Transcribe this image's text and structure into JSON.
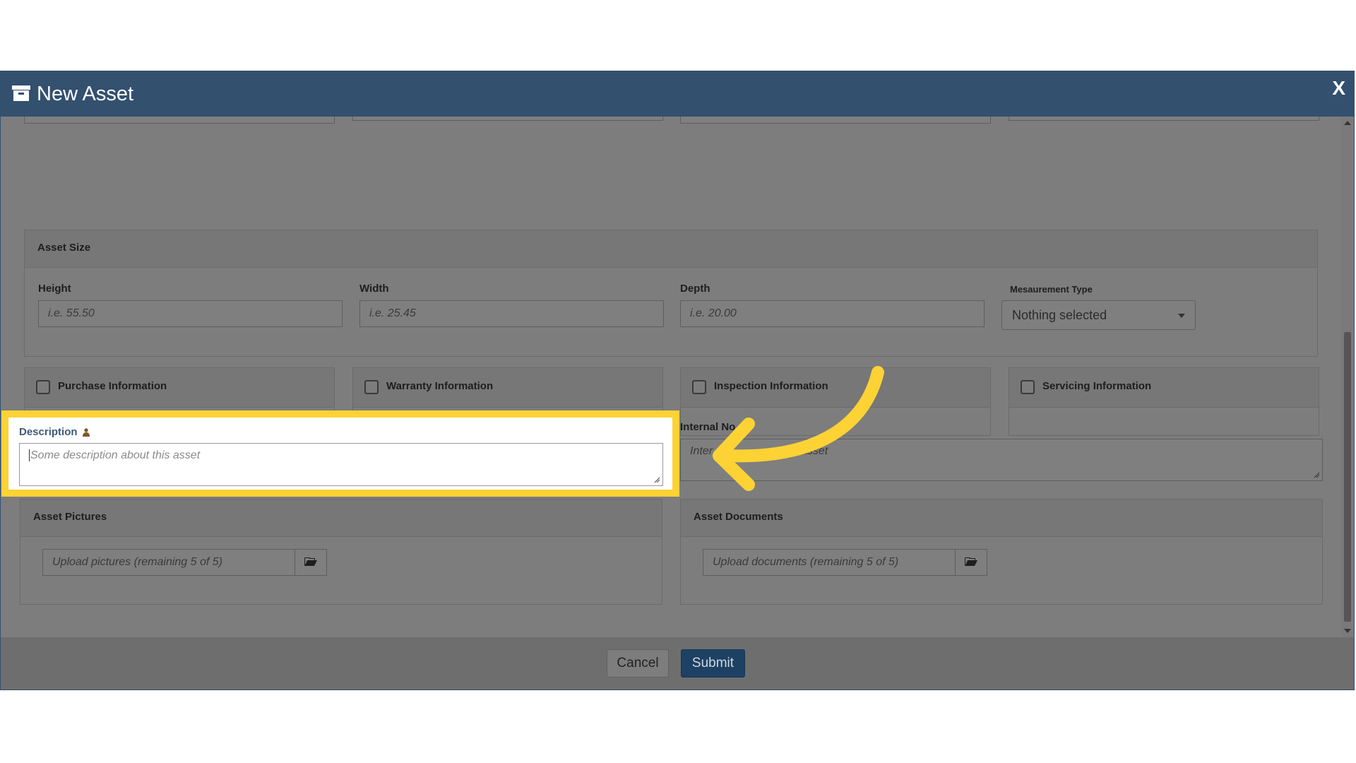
{
  "modal": {
    "title": "New Asset",
    "close_label": "X"
  },
  "asset_size": {
    "heading": "Asset Size",
    "height_label": "Height",
    "height_placeholder": "i.e. 55.50",
    "width_label": "Width",
    "width_placeholder": "i.e. 25.45",
    "depth_label": "Depth",
    "depth_placeholder": "i.e. 20.00",
    "measurement_label": "Mesaurement Type",
    "measurement_value": "Nothing selected"
  },
  "info_sections": [
    {
      "label": "Purchase Information",
      "checked": false
    },
    {
      "label": "Warranty Information",
      "checked": false
    },
    {
      "label": "Inspection Information",
      "checked": false
    },
    {
      "label": "Servicing Information",
      "checked": false
    }
  ],
  "description": {
    "label": "Description",
    "placeholder": "Some description about this asset"
  },
  "internal_notes": {
    "label": "Internal No",
    "placeholder_left": "Inter",
    "placeholder_right": "asset"
  },
  "pictures": {
    "heading": "Asset Pictures",
    "placeholder": "Upload pictures (remaining 5 of 5)"
  },
  "documents": {
    "heading": "Asset Documents",
    "placeholder": "Upload documents (remaining 5 of 5)"
  },
  "footer": {
    "cancel_label": "Cancel",
    "submit_label": "Submit"
  },
  "colors": {
    "header": "#33506f",
    "highlight": "#fdd235",
    "submit": "#1d4163"
  }
}
